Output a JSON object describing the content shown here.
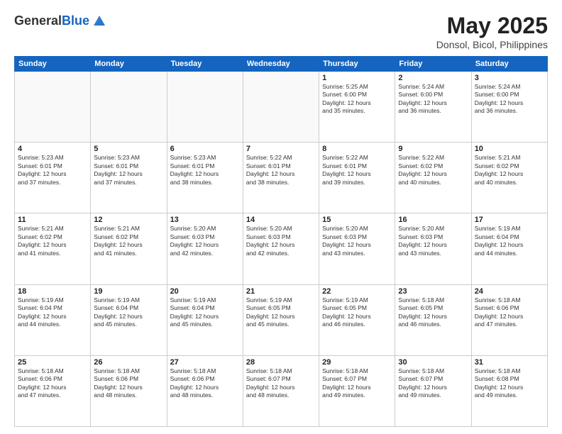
{
  "header": {
    "logo_general": "General",
    "logo_blue": "Blue",
    "title": "May 2025",
    "location": "Donsol, Bicol, Philippines"
  },
  "days_of_week": [
    "Sunday",
    "Monday",
    "Tuesday",
    "Wednesday",
    "Thursday",
    "Friday",
    "Saturday"
  ],
  "weeks": [
    [
      {
        "day": "",
        "content": ""
      },
      {
        "day": "",
        "content": ""
      },
      {
        "day": "",
        "content": ""
      },
      {
        "day": "",
        "content": ""
      },
      {
        "day": "1",
        "content": "Sunrise: 5:25 AM\nSunset: 6:00 PM\nDaylight: 12 hours\nand 35 minutes."
      },
      {
        "day": "2",
        "content": "Sunrise: 5:24 AM\nSunset: 6:00 PM\nDaylight: 12 hours\nand 36 minutes."
      },
      {
        "day": "3",
        "content": "Sunrise: 5:24 AM\nSunset: 6:00 PM\nDaylight: 12 hours\nand 36 minutes."
      }
    ],
    [
      {
        "day": "4",
        "content": "Sunrise: 5:23 AM\nSunset: 6:01 PM\nDaylight: 12 hours\nand 37 minutes."
      },
      {
        "day": "5",
        "content": "Sunrise: 5:23 AM\nSunset: 6:01 PM\nDaylight: 12 hours\nand 37 minutes."
      },
      {
        "day": "6",
        "content": "Sunrise: 5:23 AM\nSunset: 6:01 PM\nDaylight: 12 hours\nand 38 minutes."
      },
      {
        "day": "7",
        "content": "Sunrise: 5:22 AM\nSunset: 6:01 PM\nDaylight: 12 hours\nand 38 minutes."
      },
      {
        "day": "8",
        "content": "Sunrise: 5:22 AM\nSunset: 6:01 PM\nDaylight: 12 hours\nand 39 minutes."
      },
      {
        "day": "9",
        "content": "Sunrise: 5:22 AM\nSunset: 6:02 PM\nDaylight: 12 hours\nand 40 minutes."
      },
      {
        "day": "10",
        "content": "Sunrise: 5:21 AM\nSunset: 6:02 PM\nDaylight: 12 hours\nand 40 minutes."
      }
    ],
    [
      {
        "day": "11",
        "content": "Sunrise: 5:21 AM\nSunset: 6:02 PM\nDaylight: 12 hours\nand 41 minutes."
      },
      {
        "day": "12",
        "content": "Sunrise: 5:21 AM\nSunset: 6:02 PM\nDaylight: 12 hours\nand 41 minutes."
      },
      {
        "day": "13",
        "content": "Sunrise: 5:20 AM\nSunset: 6:03 PM\nDaylight: 12 hours\nand 42 minutes."
      },
      {
        "day": "14",
        "content": "Sunrise: 5:20 AM\nSunset: 6:03 PM\nDaylight: 12 hours\nand 42 minutes."
      },
      {
        "day": "15",
        "content": "Sunrise: 5:20 AM\nSunset: 6:03 PM\nDaylight: 12 hours\nand 43 minutes."
      },
      {
        "day": "16",
        "content": "Sunrise: 5:20 AM\nSunset: 6:03 PM\nDaylight: 12 hours\nand 43 minutes."
      },
      {
        "day": "17",
        "content": "Sunrise: 5:19 AM\nSunset: 6:04 PM\nDaylight: 12 hours\nand 44 minutes."
      }
    ],
    [
      {
        "day": "18",
        "content": "Sunrise: 5:19 AM\nSunset: 6:04 PM\nDaylight: 12 hours\nand 44 minutes."
      },
      {
        "day": "19",
        "content": "Sunrise: 5:19 AM\nSunset: 6:04 PM\nDaylight: 12 hours\nand 45 minutes."
      },
      {
        "day": "20",
        "content": "Sunrise: 5:19 AM\nSunset: 6:04 PM\nDaylight: 12 hours\nand 45 minutes."
      },
      {
        "day": "21",
        "content": "Sunrise: 5:19 AM\nSunset: 6:05 PM\nDaylight: 12 hours\nand 45 minutes."
      },
      {
        "day": "22",
        "content": "Sunrise: 5:19 AM\nSunset: 6:05 PM\nDaylight: 12 hours\nand 46 minutes."
      },
      {
        "day": "23",
        "content": "Sunrise: 5:18 AM\nSunset: 6:05 PM\nDaylight: 12 hours\nand 46 minutes."
      },
      {
        "day": "24",
        "content": "Sunrise: 5:18 AM\nSunset: 6:06 PM\nDaylight: 12 hours\nand 47 minutes."
      }
    ],
    [
      {
        "day": "25",
        "content": "Sunrise: 5:18 AM\nSunset: 6:06 PM\nDaylight: 12 hours\nand 47 minutes."
      },
      {
        "day": "26",
        "content": "Sunrise: 5:18 AM\nSunset: 6:06 PM\nDaylight: 12 hours\nand 48 minutes."
      },
      {
        "day": "27",
        "content": "Sunrise: 5:18 AM\nSunset: 6:06 PM\nDaylight: 12 hours\nand 48 minutes."
      },
      {
        "day": "28",
        "content": "Sunrise: 5:18 AM\nSunset: 6:07 PM\nDaylight: 12 hours\nand 48 minutes."
      },
      {
        "day": "29",
        "content": "Sunrise: 5:18 AM\nSunset: 6:07 PM\nDaylight: 12 hours\nand 49 minutes."
      },
      {
        "day": "30",
        "content": "Sunrise: 5:18 AM\nSunset: 6:07 PM\nDaylight: 12 hours\nand 49 minutes."
      },
      {
        "day": "31",
        "content": "Sunrise: 5:18 AM\nSunset: 6:08 PM\nDaylight: 12 hours\nand 49 minutes."
      }
    ]
  ]
}
